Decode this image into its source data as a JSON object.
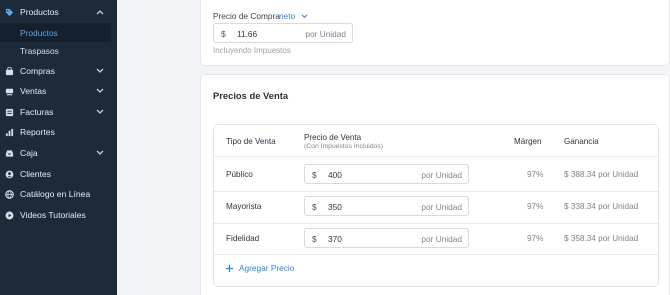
{
  "sidebar": {
    "items": [
      {
        "label": "Productos",
        "icon": "tag-icon"
      },
      {
        "label": "Compras",
        "icon": "bag-icon"
      },
      {
        "label": "Ventas",
        "icon": "register-icon"
      },
      {
        "label": "Facturas",
        "icon": "invoice-icon"
      },
      {
        "label": "Reportes",
        "icon": "bar-chart-icon"
      },
      {
        "label": "Caja",
        "icon": "tray-icon"
      },
      {
        "label": "Clientes",
        "icon": "user-icon"
      },
      {
        "label": "Catálogo en Línea",
        "icon": "globe-icon"
      },
      {
        "label": "Videos Tutoriales",
        "icon": "play-icon"
      }
    ],
    "sub_items": [
      {
        "label": "Productos",
        "active": true
      },
      {
        "label": "Traspasos",
        "active": false
      }
    ]
  },
  "purchase": {
    "label": "Precio de Compra",
    "mode": "neto",
    "currency": "$",
    "value": "11.66",
    "unit": "por Unidad",
    "hint": "Incluyendo Impuestos"
  },
  "sales": {
    "title": "Precios de Venta",
    "columns": {
      "type": "Tipo de Venta",
      "price": "Precio de Venta",
      "price_sub": "(Con Impuestos Incluidos)",
      "margin": "Márgen",
      "profit": "Ganancia"
    },
    "rows": [
      {
        "type": "Público",
        "currency": "$",
        "price": "400",
        "unit": "por Unidad",
        "margin": "97%",
        "profit": "$ 388.34 por Unidad"
      },
      {
        "type": "Mayorista",
        "currency": "$",
        "price": "350",
        "unit": "por Unidad",
        "margin": "97%",
        "profit": "$ 338.34 por Unidad"
      },
      {
        "type": "Fidelidad",
        "currency": "$",
        "price": "370",
        "unit": "por Unidad",
        "margin": "97%",
        "profit": "$ 358.34 por Unidad"
      }
    ],
    "add_label": "Agregar Precio"
  }
}
